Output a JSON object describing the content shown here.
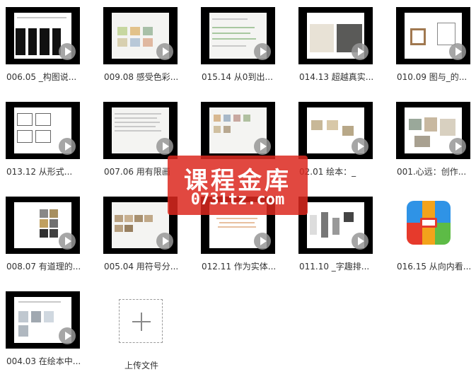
{
  "files": [
    {
      "name": "006.05 _构图说..."
    },
    {
      "name": "009.08 感受色彩..."
    },
    {
      "name": "015.14 从0到出..."
    },
    {
      "name": "014.13 超越真实..."
    },
    {
      "name": "010.09 图与_的..."
    },
    {
      "name": "013.12 从形式..."
    },
    {
      "name": "007.06 用有限画"
    },
    {
      "name": ""
    },
    {
      "name": "02.01 绘本：_"
    },
    {
      "name": "001.心远：创作..."
    },
    {
      "name": "008.07 有道理的..."
    },
    {
      "name": "005.04 用符号分..."
    },
    {
      "name": "012.11 作为实体..."
    },
    {
      "name": "011.10 _字趣排..."
    },
    {
      "name": "016.15 从向内看..."
    },
    {
      "name": "004.03 在绘本中..."
    }
  ],
  "upload": {
    "label": "上传文件"
  },
  "watermark": {
    "line1": "课程金库",
    "line2": "0731tz.com"
  },
  "colors": {
    "watermark": "#dc281e",
    "app_red": "#e63a2c",
    "app_blue": "#2f93e6",
    "app_green": "#5dbb46",
    "app_orange": "#f3a31b"
  },
  "icons": {
    "play": "play-icon",
    "add": "plus-icon",
    "app": "archive-app-icon"
  }
}
